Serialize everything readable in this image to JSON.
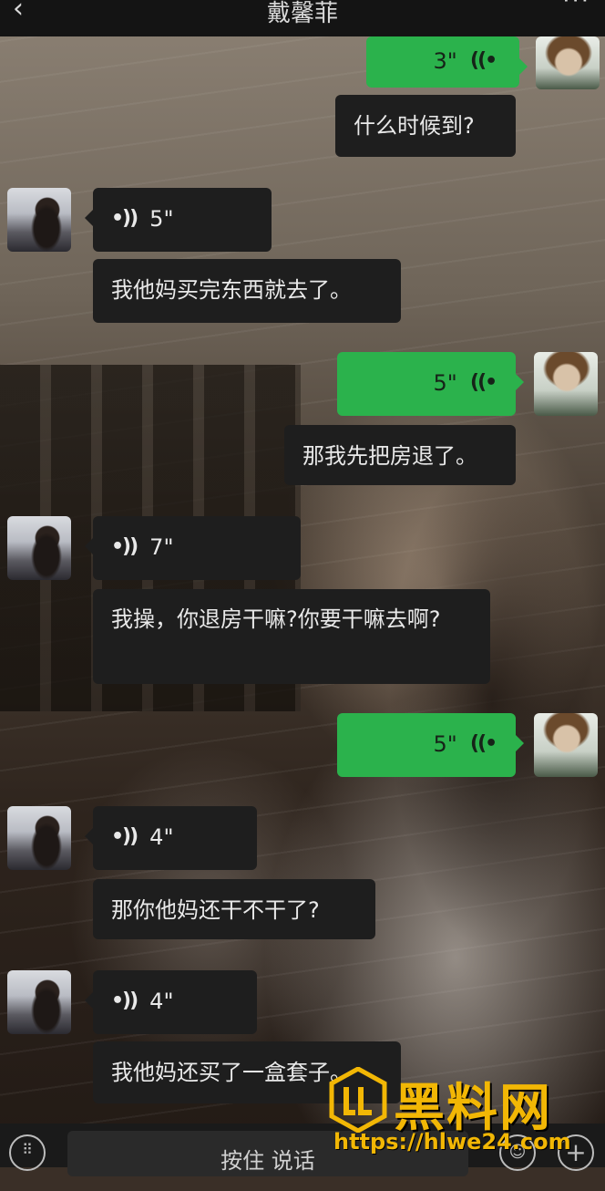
{
  "header": {
    "title": "戴馨菲",
    "back_icon": "chevron-left-icon",
    "more_icon": "ellipsis-icon"
  },
  "messages": [
    {
      "side": "right",
      "type": "voice",
      "duration": "3\""
    },
    {
      "side": "right",
      "type": "text",
      "text": "什么时候到?"
    },
    {
      "side": "left",
      "type": "voice",
      "duration": "5\""
    },
    {
      "side": "left",
      "type": "text",
      "text": "我他妈买完东西就去了。"
    },
    {
      "side": "right",
      "type": "voice",
      "duration": "5\""
    },
    {
      "side": "right",
      "type": "text",
      "text": "那我先把房退了。"
    },
    {
      "side": "left",
      "type": "voice",
      "duration": "7\""
    },
    {
      "side": "left",
      "type": "text",
      "text": "我操，你退房干嘛?你要干嘛去啊?"
    },
    {
      "side": "right",
      "type": "voice",
      "duration": "5\""
    },
    {
      "side": "left",
      "type": "voice",
      "duration": "4\""
    },
    {
      "side": "left",
      "type": "text",
      "text": "那你他妈还干不干了?"
    },
    {
      "side": "left",
      "type": "voice",
      "duration": "4\""
    },
    {
      "side": "left",
      "type": "text",
      "text": "我他妈还买了一盒套子。"
    }
  ],
  "input_bar": {
    "hold_to_talk": "按住 说话",
    "keyboard_icon": "keyboard-icon",
    "emoji_icon": "emoji-icon",
    "plus_icon": "plus-icon"
  },
  "watermark": {
    "title": "黑料网",
    "url": "https://hlwe24.com"
  },
  "colors": {
    "green_bubble": "#2bb24c",
    "dark_bubble": "#1e1e1e",
    "watermark": "#f2b705"
  }
}
